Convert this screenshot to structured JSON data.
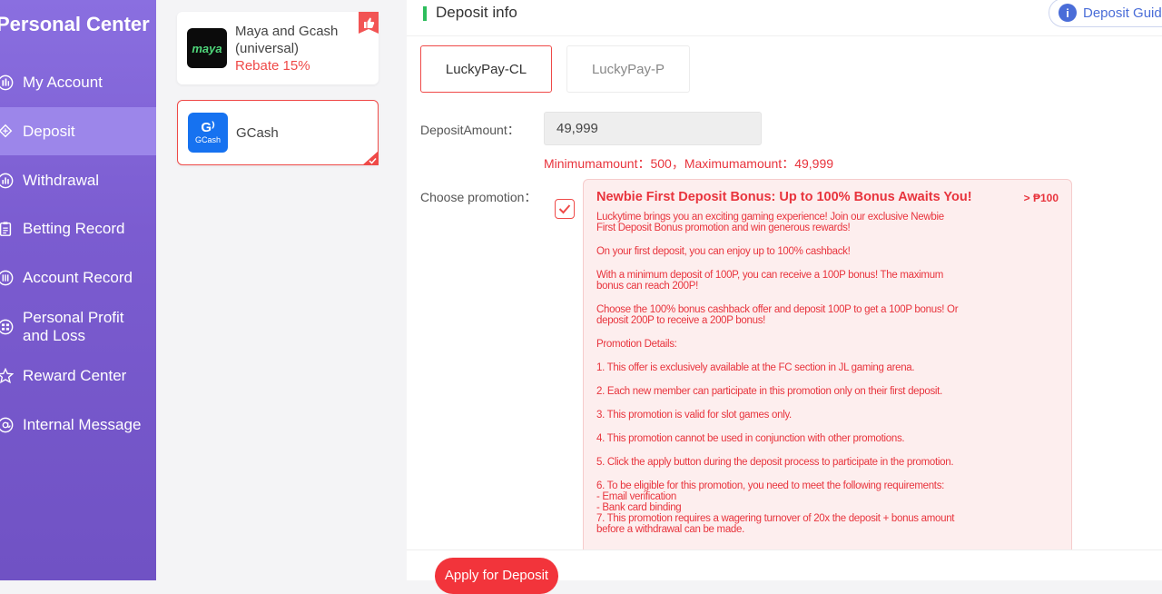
{
  "sidebar": {
    "title": "Personal Center",
    "items": [
      {
        "label": "My Account",
        "icon": "account-icon"
      },
      {
        "label": "Deposit",
        "icon": "deposit-icon",
        "active": true
      },
      {
        "label": "Withdrawal",
        "icon": "withdrawal-icon"
      },
      {
        "label": "Betting Record",
        "icon": "betting-record-icon"
      },
      {
        "label": "Account Record",
        "icon": "account-record-icon"
      },
      {
        "label": "Personal Profit and Loss",
        "icon": "profit-loss-icon"
      },
      {
        "label": "Reward Center",
        "icon": "reward-icon"
      },
      {
        "label": "Internal Message",
        "icon": "message-icon"
      }
    ]
  },
  "channels": [
    {
      "name": "Maya and Gcash (universal)",
      "rebate": "Rebate 15%",
      "logo_text": "maya",
      "hot": true
    },
    {
      "name": "GCash",
      "logo_text": "GCash",
      "selected": true
    }
  ],
  "header": {
    "title": "Deposit info",
    "guide": "Deposit Guid"
  },
  "tabs": [
    "LuckyPay-CL",
    "LuckyPay-P"
  ],
  "amount": {
    "label": "DepositAmount：",
    "value": "49,999",
    "limits": "Minimumamount：500，Maximumamount：49,999"
  },
  "promotion": {
    "label": "Choose promotion：",
    "title": "Newbie First Deposit Bonus: Up to 100% Bonus Awaits You!",
    "amount": "> ₱100",
    "paragraphs": [
      "Luckytime brings you an exciting gaming experience! Join our exclusive Newbie\nFirst Deposit Bonus promotion and win generous rewards!",
      "On your first deposit, you can enjoy up to 100% cashback!",
      "With a minimum deposit of 100P, you can receive a 100P bonus! The maximum\nbonus can reach 200P!",
      "Choose the 100% bonus cashback offer and deposit 100P to get a 100P bonus! Or\ndeposit 200P to receive a 200P bonus!",
      "Promotion Details:",
      "1. This offer is exclusively available at the FC section in JL gaming arena.",
      "2. Each new member can participate in this promotion only on their first deposit.",
      "3. This promotion is valid for slot games only.",
      "4. This promotion cannot be used in conjunction with other promotions.",
      "5. Click the apply button during the deposit process to participate in the promotion.",
      "6. To be eligible for this promotion, you need to meet the following requirements:\n - Email verification\n - Bank card binding\n7. This promotion requires a wagering turnover of 20x the deposit + bonus amount\nbefore a withdrawal can be made."
    ]
  },
  "apply_button": "Apply for Deposit",
  "colors": {
    "accent": "#ef4a48",
    "sidebar": "#7b5cd0",
    "sidebar_active": "#9c86ea",
    "indicator": "#2dbd5c"
  }
}
